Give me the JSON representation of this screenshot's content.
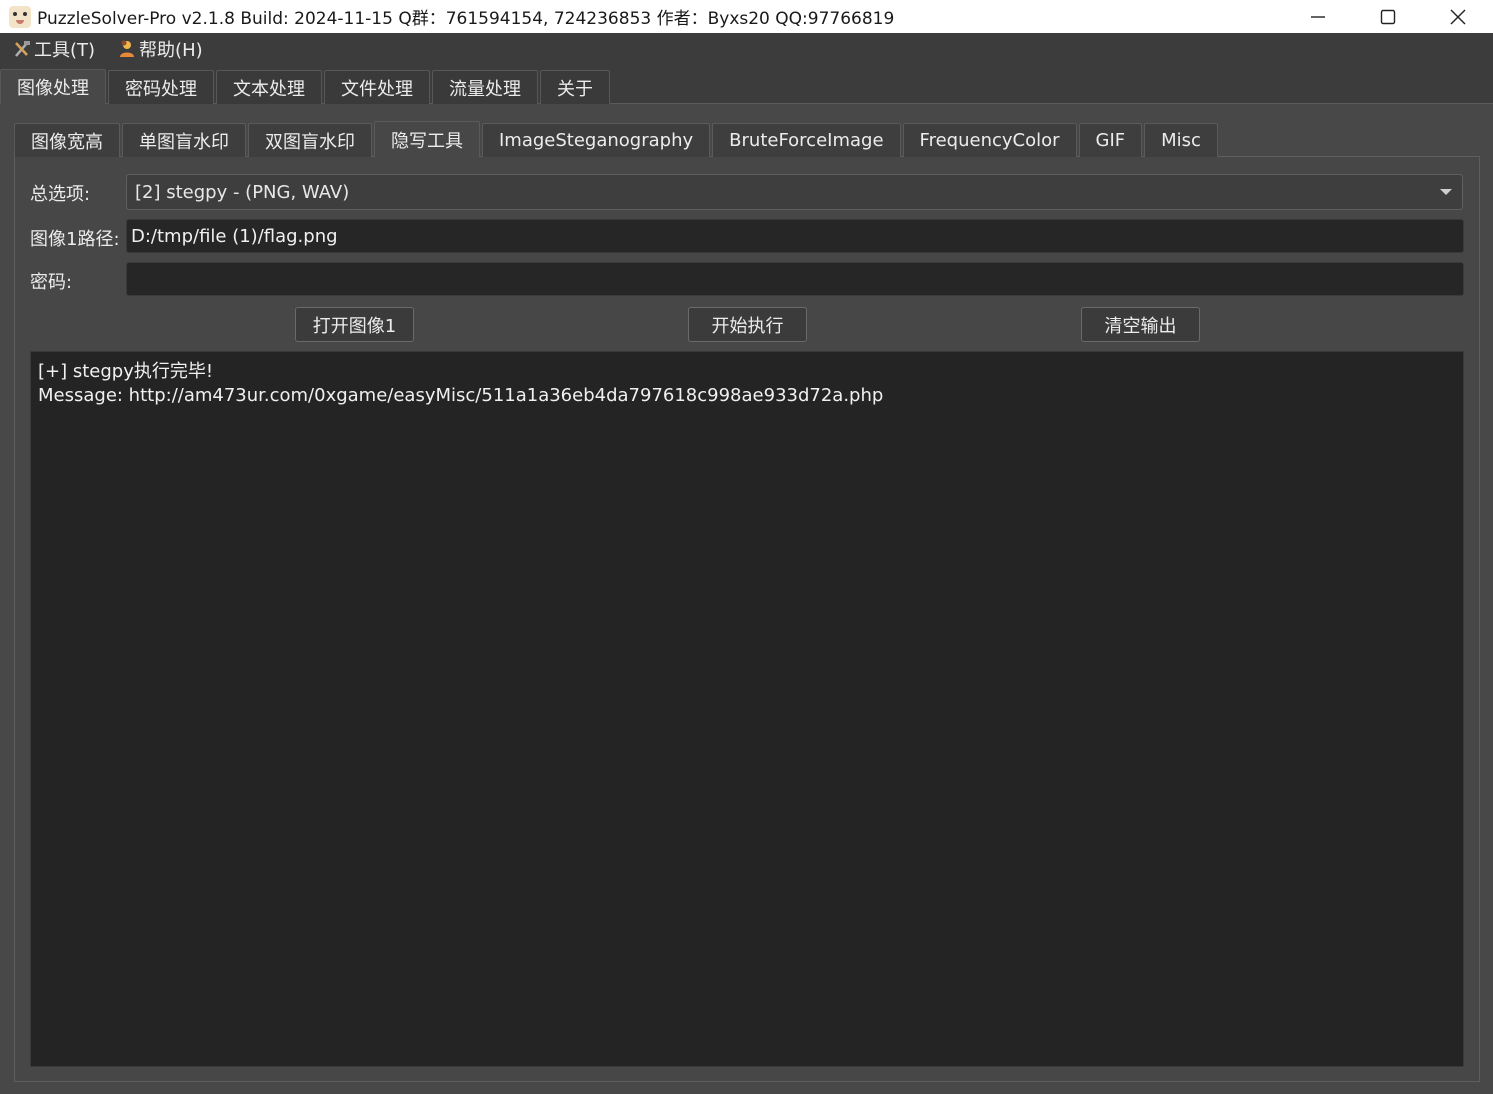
{
  "window": {
    "title": "PuzzleSolver-Pro v2.1.8  Build: 2024-11-15  Q群：761594154, 724236853  作者：Byxs20  QQ:97766819",
    "app_icon": "sheep-face-icon"
  },
  "menu": [
    {
      "label": "工具(T)",
      "icon": "tools-icon"
    },
    {
      "label": "帮助(H)",
      "icon": "person-icon"
    }
  ],
  "top_tabs": [
    {
      "label": "图像处理",
      "active": true
    },
    {
      "label": "密码处理"
    },
    {
      "label": "文本处理"
    },
    {
      "label": "文件处理"
    },
    {
      "label": "流量处理"
    },
    {
      "label": "关于"
    }
  ],
  "sub_tabs": [
    {
      "label": "图像宽高"
    },
    {
      "label": "单图盲水印"
    },
    {
      "label": "双图盲水印"
    },
    {
      "label": "隐写工具",
      "active": true
    },
    {
      "label": "ImageSteganography"
    },
    {
      "label": "BruteForceImage"
    },
    {
      "label": "FrequencyColor"
    },
    {
      "label": "GIF"
    },
    {
      "label": "Misc"
    }
  ],
  "form": {
    "option_label": "总选项:",
    "option_value": "[2] stegpy - (PNG, WAV)",
    "image1_label": "图像1路径:",
    "image1_value": "D:/tmp/file (1)/flag.png",
    "password_label": "密码:",
    "password_value": ""
  },
  "buttons": {
    "open_image": "打开图像1",
    "execute": "开始执行",
    "clear_output": "清空输出"
  },
  "output": {
    "lines": [
      "[+] stegpy执行完毕!",
      "",
      "Message: http://am473ur.com/0xgame/easyMisc/511a1a36eb4da797618c998ae933d72a.php"
    ]
  },
  "colors": {
    "background": "#3c3c3c",
    "panel": "#474747",
    "field": "#262626",
    "output": "#242424",
    "text": "#ececec"
  }
}
